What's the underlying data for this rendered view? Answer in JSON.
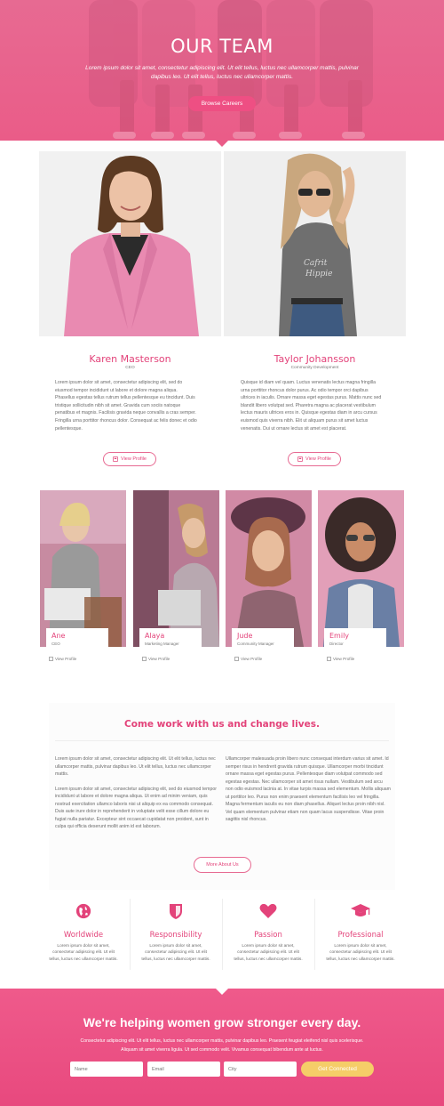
{
  "hero": {
    "title": "OUR TEAM",
    "subtitle": "Lorem ipsum dolor sit amet, consectetur adipiscing elit. Ut elit tellus, luctus nec ullamcorper mattis, pulvinar dapibus leo. Ut elit tellus, luctus nec ullamcorper mattis.",
    "button": "Browse Careers"
  },
  "featured": [
    {
      "name": "Karen Masterson",
      "role": "CEO",
      "bio": "Lorem ipsum dolor sit amet, consectetur adipiscing elit, sed do eiusmod tempor incididunt ut labore et dolore magna aliqua. Phasellus egestas tellus rutrum tellus pellentesque eu tincidunt. Duis tristique sollicitudin nibh sit amet. Gravida cum sociis natoque penatibus et magnis. Facilisis gravida neque convallis a cras semper. Fringilla urna porttitor rhoncus dolor. Consequat ac felis donec et odio pellentesque.",
      "button": "View Profile"
    },
    {
      "name": "Taylor Johansson",
      "role": "Community Development",
      "bio": "Quisque id diam vel quam. Luctus venenatis lectus magna fringilla urna porttitor rhoncus dolor purus. Ac odio tempor orci dapibus ultrices in iaculis. Ornare massa eget egestas purus. Mattis nunc sed blandit libero volutpat sed. Pharetra magna ac placerat vestibulum lectus mauris ultrices eros in. Quisque egestas diam in arcu cursus euismod quis viverra nibh. Elit ut aliquam purus sit amet luctus venenatis. Dui ut ornare lectus sit amet est placerat.",
      "button": "View Profile"
    }
  ],
  "team": [
    {
      "name": "Ane",
      "role": "CEO",
      "link": "View Profile"
    },
    {
      "name": "Alaya",
      "role": "Marketing Manager",
      "link": "View Profile"
    },
    {
      "name": "Jude",
      "role": "Community Manager",
      "link": "View Profile"
    },
    {
      "name": "Emily",
      "role": "Director",
      "link": "View Profile"
    }
  ],
  "career": {
    "title": "Come work with us and change lives.",
    "left_p1": "Lorem ipsum dolor sit amet, consectetur adipiscing elit. Ut elit tellus, luctus nec ullamcorper mattis, pulvinar dapibus leo. Ut elit tellus, luctus nec ullamcorper mattis.",
    "left_p2": "Lorem ipsum dolor sit amet, consectetur adipiscing elit, sed do eiusmod tempor incididunt ut labore et dolore magna aliqua. Ut enim ad minim veniam, quis nostrud exercitation ullamco laboris nisi ut aliquip ex ea commodo consequat. Duis aute irure dolor in reprehenderit in voluptate velit esse cillum dolore eu fugiat nulla pariatur. Excepteur sint occaecat cupidatat non proident, sunt in culpa qui officia deserunt mollit anim id est laborum.",
    "right_p": "Ullamcorper malesuada proin libero nunc consequat interdum varius sit amet. Id semper risus in hendrerit gravida rutrum quisque. Ullamcorper morbi tincidunt ornare massa eget egestas purus. Pellentesque diam volutpat commodo sed egestas egestas. Nec ullamcorper sit amet risus nullam. Vestibulum sed arcu non odio euismod lacinia at. In vitae turpis massa sed elementum. Mollis aliquam ut porttitor leo. Purus non enim praesent elementum facilisis leo vel fringilla. Magna fermentum iaculis eu non diam phasellus. Aliquet lectus proin nibh nisl. Vel quam elementum pulvinar etiam non quam lacus suspendisse. Vitae proin sagittis nisl rhoncus.",
    "button": "More About Us"
  },
  "values": [
    {
      "title": "Worldwide",
      "icon": "globe-icon",
      "text": "Lorem ipsum dolor sit amet, consectetur adipiscing elit. Ut elit tellus, luctus nec ullamcorper mattis."
    },
    {
      "title": "Responsibility",
      "icon": "shield-icon",
      "text": "Lorem ipsum dolor sit amet, consectetur adipiscing elit. Ut elit tellus, luctus nec ullamcorper mattis."
    },
    {
      "title": "Passion",
      "icon": "heart-icon",
      "text": "Lorem ipsum dolor sit amet, consectetur adipiscing elit. Ut elit tellus, luctus nec ullamcorper mattis."
    },
    {
      "title": "Professional",
      "icon": "graduation-cap-icon",
      "text": "Lorem ipsum dolor sit amet, consectetur adipiscing elit. Ut elit tellus, luctus nec ullamcorper mattis."
    }
  ],
  "cta": {
    "title": "We're helping women grow stronger every day.",
    "text": "Consectetur adipiscing elit. Ut elit tellus, luctus nec ullamcorper mattis, pulvinar dapibus leo. Praesent feugiat eleifend nisl quis scelerisque. Aliquam sit amet viverra ligula. Ut sed commodo velit. Vivamus consequat bibendum ante at luctus.",
    "name_placeholder": "Name",
    "email_placeholder": "Email",
    "city_placeholder": "City",
    "button": "Get Connected"
  },
  "colors": {
    "accent": "#e3437a",
    "hero": "#ea5c88",
    "cta_button": "#f5cd68"
  }
}
